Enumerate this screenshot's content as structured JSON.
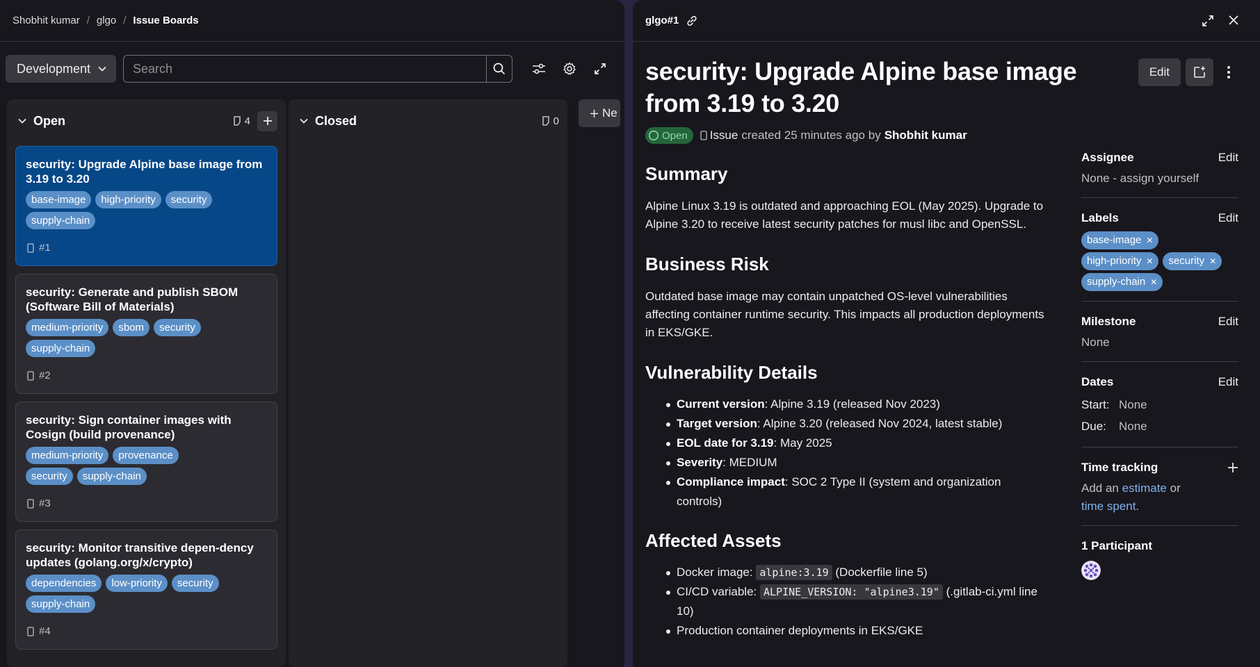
{
  "breadcrumb": [
    "Shobhit kumar",
    "glgo",
    "Issue Boards"
  ],
  "board": {
    "selector_label": "Development",
    "search_placeholder": "Search",
    "new_list_label": "Ne"
  },
  "lists": [
    {
      "title": "Open",
      "count": "4",
      "cards": [
        {
          "title": "security: Upgrade Alpine base image from 3.19 to 3.20",
          "labels": [
            "base-image",
            "high-priority",
            "security",
            "supply-chain"
          ],
          "ref": "#1"
        },
        {
          "title": "security: Generate and publish SBOM (Software Bill of Materials)",
          "labels": [
            "medium-priority",
            "sbom",
            "security",
            "supply-chain"
          ],
          "ref": "#2"
        },
        {
          "title": "security: Sign container images with Cosign (build provenance)",
          "labels": [
            "medium-priority",
            "provenance",
            "security",
            "supply-chain"
          ],
          "ref": "#3"
        },
        {
          "title": "security: Monitor transitive depen-dency updates (golang.org/x/crypto)",
          "labels": [
            "dependencies",
            "low-priority",
            "security",
            "supply-chain"
          ],
          "ref": "#4"
        }
      ]
    },
    {
      "title": "Closed",
      "count": "0",
      "cards": []
    }
  ],
  "drawer": {
    "ref": "glgo#1",
    "title": "security: Upgrade Alpine base image from 3.19 to 3.20",
    "edit_label": "Edit",
    "status": "Open",
    "type": "Issue",
    "created_text": "created 25 minutes ago by",
    "author": "Shobhit kumar",
    "summary_heading": "Summary",
    "summary_text": "Alpine Linux 3.19 is outdated and approaching EOL (May 2025). Upgrade to Alpine 3.20 to receive latest security patches for musl libc and OpenSSL.",
    "risk_heading": "Business Risk",
    "risk_text": "Outdated base image may contain unpatched OS-level vulnerabilities affecting container runtime security. This impacts all production deployments in EKS/GKE.",
    "vuln_heading": "Vulnerability Details",
    "vuln_items": [
      {
        "key": "Current version",
        "value": ": Alpine 3.19 (released Nov 2023)"
      },
      {
        "key": "Target version",
        "value": ": Alpine 3.20 (released Nov 2024, latest stable)"
      },
      {
        "key": "EOL date for 3.19",
        "value": ": May 2025"
      },
      {
        "key": "Severity",
        "value": ": MEDIUM"
      },
      {
        "key": "Compliance impact",
        "value": ": SOC 2 Type II (system and organization controls)"
      }
    ],
    "assets_heading": "Affected Assets",
    "assets": [
      {
        "prefix": "Docker image: ",
        "code": "alpine:3.19",
        "suffix": " (Dockerfile line 5)"
      },
      {
        "prefix": "CI/CD variable: ",
        "code": "ALPINE_VERSION: \"alpine3.19\"",
        "suffix": " (.gitlab-ci.yml line 10)"
      },
      {
        "prefix": "Production container deployments in EKS/GKE",
        "code": "",
        "suffix": ""
      }
    ]
  },
  "sidebar": {
    "assignee_title": "Assignee",
    "assignee_value": "None - assign yourself",
    "labels_title": "Labels",
    "labels": [
      "base-image",
      "high-priority",
      "security",
      "supply-chain"
    ],
    "milestone_title": "Milestone",
    "milestone_value": "None",
    "dates_title": "Dates",
    "start_label": "Start:",
    "start_value": "None",
    "due_label": "Due:",
    "due_value": "None",
    "time_title": "Time tracking",
    "time_prefix": "Add an",
    "time_estimate": "estimate",
    "time_or": "or",
    "time_spent": "time spent.",
    "participants_title": "1 Participant",
    "edit": "Edit"
  },
  "colors": {
    "label": "#5b8fc7",
    "active_card": "#064787",
    "status_open": "#24663b"
  }
}
